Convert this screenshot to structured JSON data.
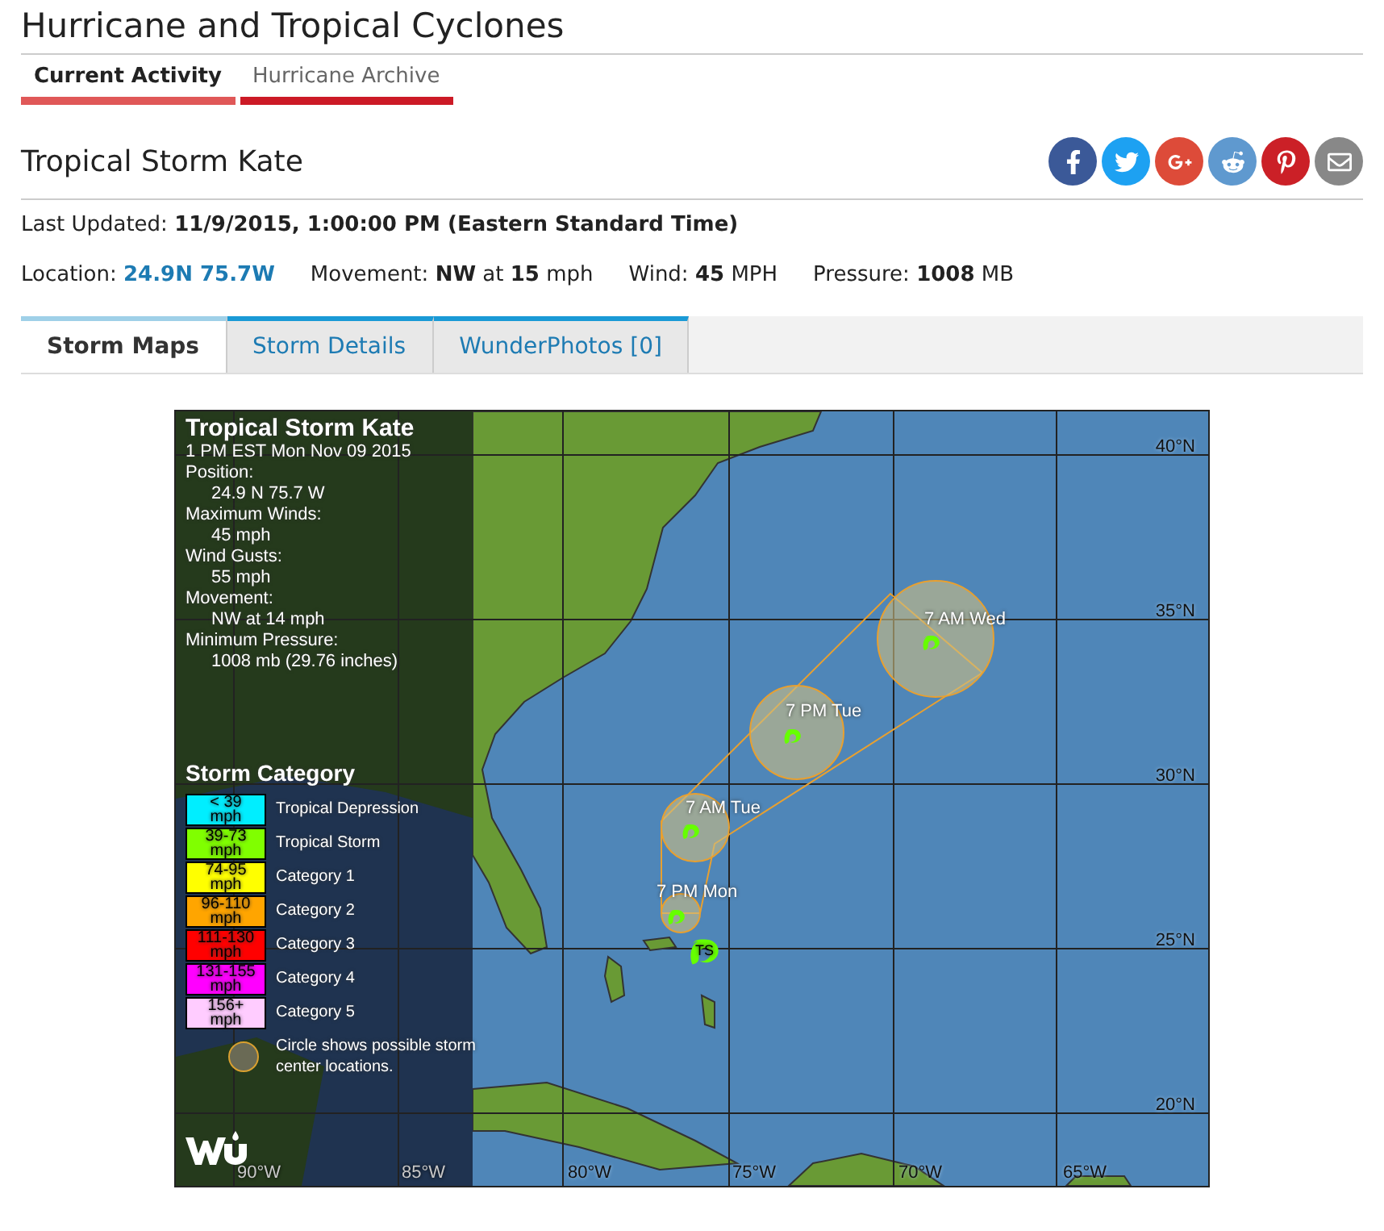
{
  "page_title": "Hurricane and Tropical Cyclones",
  "nav_tabs": [
    {
      "label": "Current Activity",
      "selected": true
    },
    {
      "label": "Hurricane Archive",
      "selected": false
    }
  ],
  "storm_name": "Tropical Storm Kate",
  "share_buttons": [
    {
      "kind": "facebook"
    },
    {
      "kind": "twitter"
    },
    {
      "kind": "googleplus"
    },
    {
      "kind": "reddit"
    },
    {
      "kind": "pinterest"
    },
    {
      "kind": "email"
    }
  ],
  "last_updated": {
    "label": "Last Updated:",
    "value": "11/9/2015, 1:00:00 PM (Eastern Standard Time)"
  },
  "stats": [
    {
      "label": "Location:",
      "value": "24.9N 75.7W",
      "kind": "link"
    },
    {
      "label": "Movement:",
      "value": "**NW** at **15** mph",
      "kind": "text"
    },
    {
      "label": "Wind:",
      "value": "**45** MPH",
      "kind": "text"
    },
    {
      "label": "Pressure:",
      "value": "**1008** MB",
      "kind": "text"
    }
  ],
  "content_tabs": [
    {
      "label": "Storm Maps",
      "selected": true
    },
    {
      "label": "Storm Details",
      "selected": false
    },
    {
      "label": "WunderPhotos [0]",
      "selected": false
    }
  ],
  "map": {
    "info_title": "Tropical Storm Kate",
    "info_lines": [
      {
        "text": "1 PM EST Mon Nov 09 2015",
        "indent": false
      },
      {
        "text": "Position:",
        "indent": false
      },
      {
        "text": "24.9 N 75.7 W",
        "indent": true
      },
      {
        "text": "Maximum Winds:",
        "indent": false
      },
      {
        "text": "45 mph",
        "indent": true
      },
      {
        "text": "Wind Gusts:",
        "indent": false
      },
      {
        "text": "55 mph",
        "indent": true
      },
      {
        "text": "Movement:",
        "indent": false
      },
      {
        "text": "NW at 14 mph",
        "indent": true
      },
      {
        "text": "Minimum Pressure:",
        "indent": false
      },
      {
        "text": "1008 mb (29.76 inches)",
        "indent": true
      }
    ],
    "legend_title": "Storm Category",
    "categories": [
      {
        "speed": "< 39",
        "unit": "mph",
        "label": "Tropical Depression",
        "color": "#00eeff"
      },
      {
        "speed": "39-73",
        "unit": "mph",
        "label": "Tropical Storm",
        "color": "#80ff00"
      },
      {
        "speed": "74-95",
        "unit": "mph",
        "label": "Category 1",
        "color": "#ffff00"
      },
      {
        "speed": "96-110",
        "unit": "mph",
        "label": "Category 2",
        "color": "#ffa500"
      },
      {
        "speed": "111-130",
        "unit": "mph",
        "label": "Category 3",
        "color": "#ff0000"
      },
      {
        "speed": "131-155",
        "unit": "mph",
        "label": "Category 4",
        "color": "#ff00ff"
      },
      {
        "speed": "156+",
        "unit": "mph",
        "label": "Category 5",
        "color": "#ffccff"
      }
    ],
    "circle_note": "Circle shows possible storm center locations.",
    "current_storm": {
      "label": "TS"
    },
    "forecast_points": [
      {
        "label": "7 PM Mon"
      },
      {
        "label": "7 AM Tue"
      },
      {
        "label": "7 PM Tue"
      },
      {
        "label": "7 AM Wed"
      }
    ],
    "lat_labels": [
      "40°N",
      "35°N",
      "30°N",
      "25°N",
      "20°N"
    ],
    "lon_labels": [
      "90°W",
      "85°W",
      "80°W",
      "75°W",
      "70°W",
      "65°W"
    ]
  }
}
